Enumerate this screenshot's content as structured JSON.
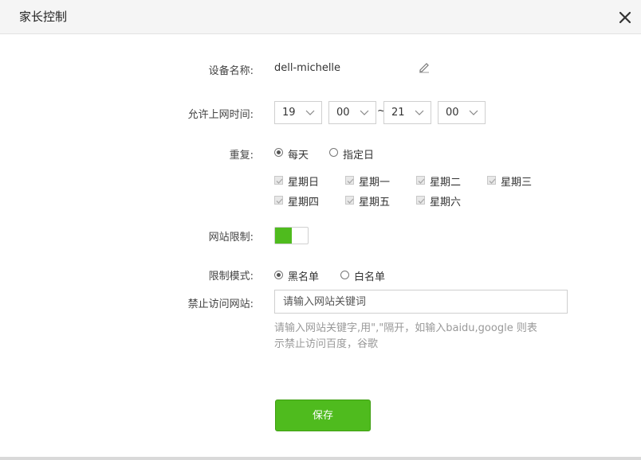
{
  "dialog": {
    "title": "家长控制",
    "close_icon": "close-icon"
  },
  "device": {
    "label": "设备名称:",
    "name": "dell-michelle",
    "edit_icon": "pencil-icon"
  },
  "time": {
    "label": "允许上网时间:",
    "start_hour": "19",
    "start_minute": "00",
    "separator": "~",
    "end_hour": "21",
    "end_minute": "00"
  },
  "repeat": {
    "label": "重复:",
    "option_everyday": "每天",
    "option_specific": "指定日",
    "selected": "每天",
    "days": [
      "星期日",
      "星期一",
      "星期二",
      "星期三",
      "星期四",
      "星期五",
      "星期六"
    ],
    "days_checked": true
  },
  "site_limit": {
    "label": "网站限制:",
    "enabled": true,
    "color": "#4fbb1e"
  },
  "mode": {
    "label": "限制模式:",
    "option_black": "黑名单",
    "option_white": "白名单",
    "selected": "黑名单"
  },
  "blocked": {
    "label": "禁止访问网站:",
    "placeholder": "请输入网站关键词",
    "hint_line1": "请输入网站关键字,用\",\"隔开，如输入baidu,google 则表",
    "hint_line2": "示禁止访问百度，谷歌"
  },
  "save": {
    "label": "保存",
    "color": "#4fbb1e"
  }
}
